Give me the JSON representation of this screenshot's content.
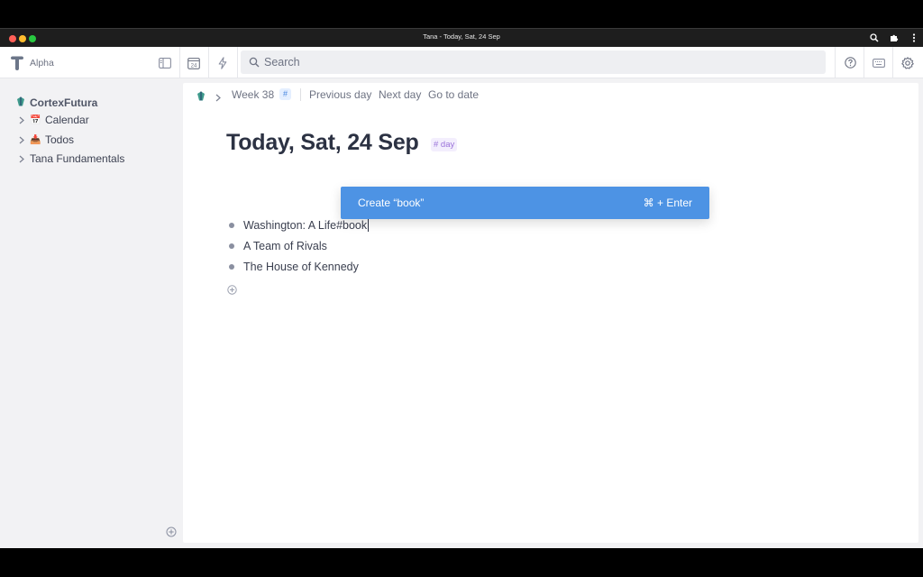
{
  "window": {
    "title": "Tana - Today, Sat, 24 Sep"
  },
  "topbar": {
    "workspace": "Alpha",
    "search_placeholder": "Search",
    "calendar_day": "24"
  },
  "sidebar": {
    "workspace_label": "CortexFutura",
    "items": [
      {
        "emoji": "📅",
        "label": "Calendar"
      },
      {
        "emoji": "📥",
        "label": "Todos"
      },
      {
        "emoji": "",
        "label": "Tana Fundamentals"
      }
    ]
  },
  "breadcrumb": {
    "week": "Week 38",
    "hash": "#",
    "previous_day": "Previous day",
    "next_day": "Next day",
    "go_to_date": "Go to date"
  },
  "page": {
    "title": "Today, Sat, 24 Sep",
    "tag": "# day",
    "nodes": [
      {
        "text": "Washington: A Life#book"
      },
      {
        "text": "A Team of Rivals"
      },
      {
        "text": "The House of Kennedy"
      }
    ]
  },
  "popup": {
    "label": "Create “book”",
    "shortcut": "⌘ + Enter"
  },
  "colors": {
    "accent": "#4d93e4",
    "tag": "#9a72d9",
    "sidebar_bg": "#f2f2f4"
  },
  "icons": {
    "titlebar": [
      "zoom-icon",
      "extension-icon",
      "kebab-menu-icon"
    ],
    "topbar": [
      "tana-logo",
      "sidebar-toggle-icon",
      "calendar-icon",
      "lightning-icon",
      "search-icon",
      "help-icon",
      "keyboard-icon",
      "settings-icon"
    ]
  }
}
